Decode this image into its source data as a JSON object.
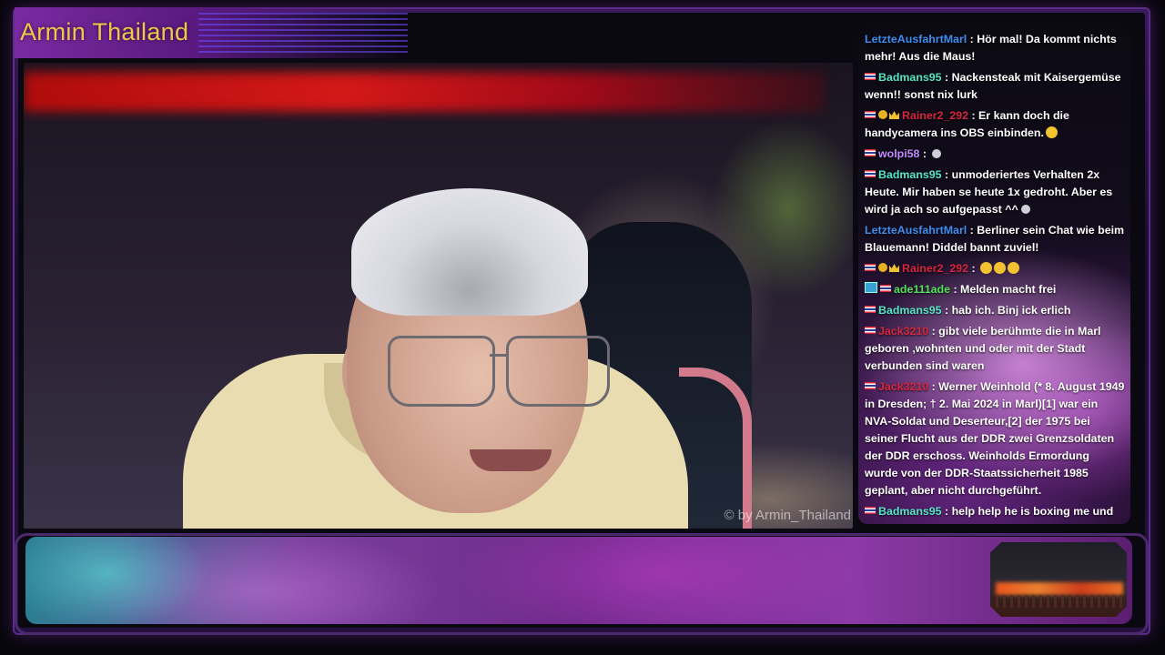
{
  "channel": {
    "title": "Armin Thailand",
    "watermark": "© by Armin_Thailand"
  },
  "colors": {
    "title": "#f1c64a",
    "frame_purple": "#5b2c8c",
    "bar_teal": "#2b7f93",
    "bar_purple": "#7a3e9c"
  },
  "chat": {
    "messages": [
      {
        "user": "LetzteAusfahrtMarl",
        "sep": " : ",
        "text": "Hör mal! Da kommt nichts mehr! Aus die Maus!"
      },
      {
        "user": "Badmans95",
        "sep": " : ",
        "text": "Nackensteak mit Kaisergemüse wenn!! sonst nix lurk"
      },
      {
        "user": "Rainer2_292",
        "sep": " : ",
        "text": "Er kann doch die handycamera ins OBS einbinden."
      },
      {
        "user": "wolpi58",
        "sep": " : ",
        "text": ""
      },
      {
        "user": "Badmans95",
        "sep": " : ",
        "text": "unmoderiertes Verhalten 2x Heute. Mir haben se heute 1x gedroht. Aber es wird ja ach so aufgepasst ^^"
      },
      {
        "user": "LetzteAusfahrtMarl",
        "sep": " : ",
        "text": "Berliner sein Chat wie beim Blauemann! Diddel bannt zuviel!"
      },
      {
        "user": "Rainer2_292",
        "sep": " : ",
        "text": ""
      },
      {
        "user": "ade111ade",
        "sep": " : ",
        "text": "Melden macht frei"
      },
      {
        "user": "Badmans95",
        "sep": " : ",
        "text": "hab ich. Binj ick erlich"
      },
      {
        "user": "Jack3210",
        "sep": " : ",
        "text": "gibt viele berühmte die in Marl geboren ,wohnten und oder mit der Stadt verbunden sind waren"
      },
      {
        "user": "Jack3210",
        "sep": " : ",
        "text": "Werner Weinhold (* 8. August 1949 in Dresden; † 2. Mai 2024 in Marl)[1] war ein NVA-Soldat und Deserteur,[2] der 1975 bei seiner Flucht aus der DDR zwei Grenzsoldaten der DDR erschoss. Weinholds Ermordung wurde von der DDR-Staatssicherheit 1985 geplant, aber nicht durchgeführt."
      },
      {
        "user": "Badmans95",
        "sep": " : ",
        "text": "help help he is boxing me und so"
      }
    ]
  }
}
